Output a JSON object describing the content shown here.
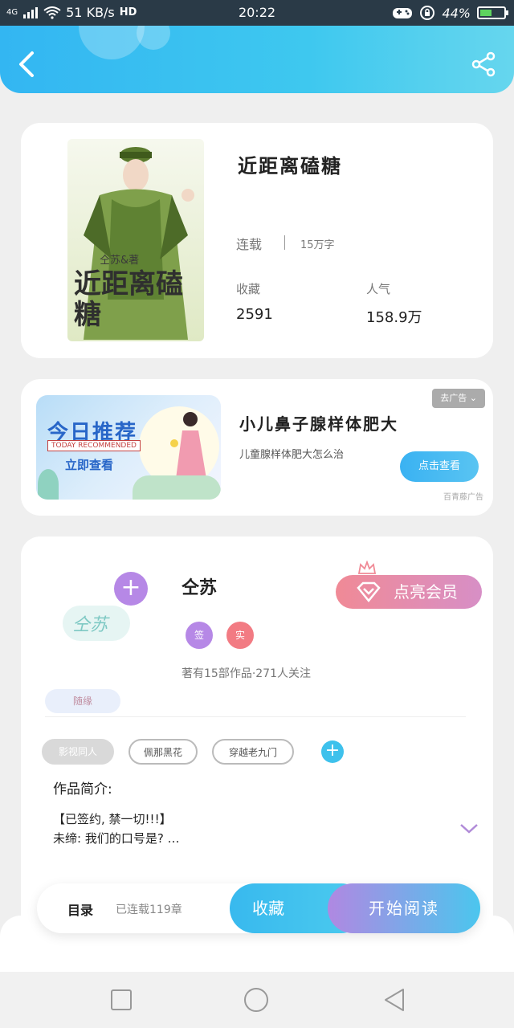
{
  "status_bar": {
    "network": "4G",
    "speed": "51 KB/s",
    "hd": "HD",
    "time": "20:22",
    "battery": "44%"
  },
  "header": {
    "back_icon": "chevron-left-icon",
    "share_icon": "share-icon"
  },
  "book": {
    "title": "近距离磕糖",
    "cover_title": "近距离磕糖",
    "cover_author": "仝苏&著",
    "status": "连载",
    "words": "15万字",
    "collect_label": "收藏",
    "collect_value": "2591",
    "popularity_label": "人气",
    "popularity_value": "158.9万"
  },
  "ad": {
    "banner_main": "今日推荐",
    "banner_sub": "TODAY RECOMMENDED",
    "banner_cta": "立即查看",
    "title": "小儿鼻子腺样体肥大",
    "description": "儿童腺样体肥大怎么治",
    "close_label": "去广告",
    "view_button": "点击查看",
    "source": "百青藤广告"
  },
  "author": {
    "name": "仝苏",
    "signature": "仝苏",
    "tag_signed": "签",
    "tag_real": "实",
    "meta": "著有15部作品·271人关注",
    "follow_label": "随缘",
    "vip_button": "点亮会员",
    "genres": [
      "影视同人",
      "佩那黑花",
      "穿越老九门"
    ],
    "intro_label": "作品简介:",
    "intro_line1": "【已签约, 禁一切!!!】",
    "intro_line2": "未缔: 我们的口号是? …"
  },
  "actions": {
    "catalog": "目录",
    "catalog_count": "已连载119章",
    "collect": "收藏",
    "read": "开始阅读"
  },
  "colors": {
    "accent": "#3ec1ec",
    "vip": "#f08a96",
    "purple": "#b688e6"
  }
}
